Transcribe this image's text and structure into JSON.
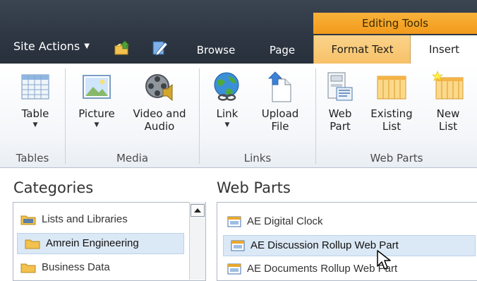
{
  "topbar": {
    "site_actions": "Site Actions",
    "tabs": [
      {
        "label": "Browse"
      },
      {
        "label": "Page"
      },
      {
        "label": "Format Text"
      },
      {
        "label": "Insert"
      }
    ],
    "contextual_group": "Editing Tools"
  },
  "ribbon": {
    "groups": [
      {
        "label": "Tables"
      },
      {
        "label": "Media"
      },
      {
        "label": "Links"
      },
      {
        "label": "Web Parts"
      }
    ],
    "buttons": [
      {
        "label": "Table",
        "icon": "table-icon"
      },
      {
        "label": "Picture",
        "icon": "picture-icon"
      },
      {
        "label": "Video and\nAudio",
        "icon": "video-audio-icon"
      },
      {
        "label": "Link",
        "icon": "link-globe-icon"
      },
      {
        "label": "Upload\nFile",
        "icon": "upload-file-icon"
      },
      {
        "label": "Web\nPart",
        "icon": "web-part-icon"
      },
      {
        "label": "Existing\nList",
        "icon": "existing-list-icon"
      },
      {
        "label": "New\nList",
        "icon": "new-list-icon"
      }
    ]
  },
  "categories": {
    "title": "Categories",
    "items": [
      {
        "label": "Lists and Libraries"
      },
      {
        "label": "Amrein Engineering",
        "selected": true
      },
      {
        "label": "Business Data"
      }
    ]
  },
  "webparts": {
    "title": "Web Parts",
    "items": [
      {
        "label": "AE Digital Clock"
      },
      {
        "label": "AE Discussion Rollup Web Part",
        "selected": true
      },
      {
        "label": "AE Documents Rollup Web Part"
      }
    ]
  },
  "colors": {
    "topbar": "#2d3642",
    "editing_tools": "#f29a1b",
    "format_tab": "#f7c168",
    "selection": "#dbe8f5"
  }
}
